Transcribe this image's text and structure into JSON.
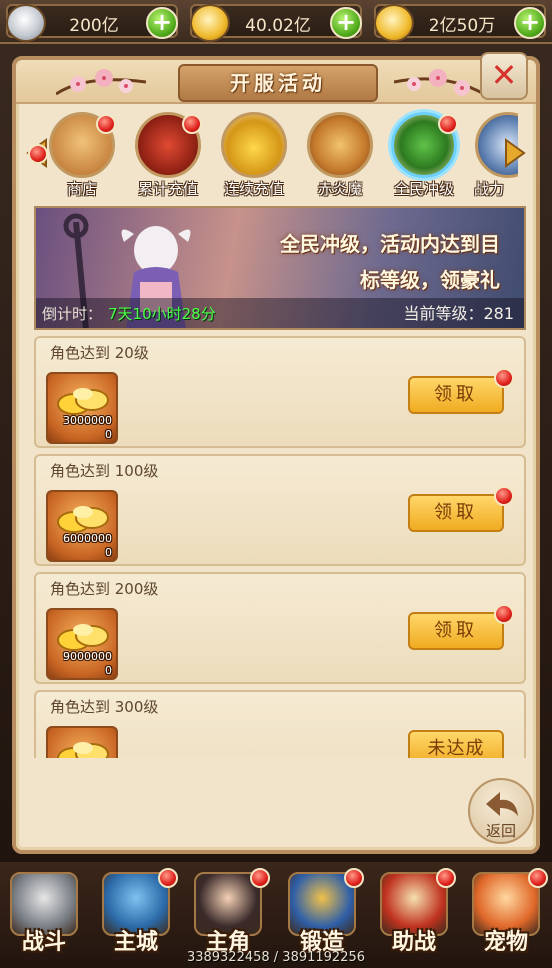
{
  "currency": [
    {
      "value": "200亿",
      "icon": "silver-ingot-icon"
    },
    {
      "value": "40.02亿",
      "icon": "gold-ingot-icon"
    },
    {
      "value": "2亿50万",
      "icon": "bound-gold-ingot-icon"
    }
  ],
  "panel": {
    "title": "开服活动",
    "tabs": [
      {
        "label": "商店",
        "icon": "shop-icon",
        "dot": true
      },
      {
        "label": "累计充值",
        "icon": "treasure-chest-icon",
        "dot": true
      },
      {
        "label": "连续充值",
        "icon": "gold-pile-icon",
        "dot": false
      },
      {
        "label": "赤炎魔",
        "icon": "flame-demon-icon",
        "dot": false
      },
      {
        "label": "全民冲级",
        "icon": "level-up-shield-icon",
        "dot": true,
        "active": true
      },
      {
        "label": "战力",
        "icon": "warrior-icon",
        "dot": false
      }
    ]
  },
  "banner": {
    "line1": "全民冲级，活动内达到目",
    "line2": "标等级，领豪礼",
    "countdown_label": "倒计时：",
    "countdown_value": "7天10小时28分",
    "level_text": "当前等级：281"
  },
  "rewards": [
    {
      "requirement": "角色达到 20级",
      "amount": "3000000",
      "sub": "0",
      "button": "领取",
      "dot": true
    },
    {
      "requirement": "角色达到 100级",
      "amount": "6000000",
      "sub": "0",
      "button": "领取",
      "dot": true
    },
    {
      "requirement": "角色达到 200级",
      "amount": "9000000",
      "sub": "0",
      "button": "领取",
      "dot": true
    },
    {
      "requirement": "角色达到 300级",
      "amount": "",
      "sub": "",
      "button": "未达成",
      "dot": false
    }
  ],
  "back_label": "返回",
  "nav": [
    {
      "label": "战斗",
      "icon": "battle-swords-icon",
      "dot": false
    },
    {
      "label": "主城",
      "icon": "main-city-icon",
      "dot": true
    },
    {
      "label": "主角",
      "icon": "hero-portrait-icon",
      "dot": true
    },
    {
      "label": "锻造",
      "icon": "forge-icon",
      "dot": true
    },
    {
      "label": "助战",
      "icon": "assist-scroll-icon",
      "dot": true
    },
    {
      "label": "宠物",
      "icon": "pet-icon",
      "dot": true
    }
  ],
  "ids": "3389322458 / 3891192256"
}
